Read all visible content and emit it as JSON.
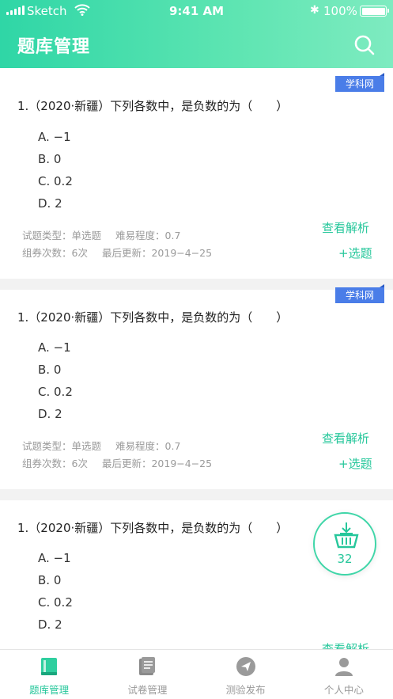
{
  "status_bar": {
    "carrier": "Sketch",
    "time": "9:41 AM",
    "battery": "100%"
  },
  "header": {
    "title": "题库管理"
  },
  "questions": [
    {
      "tag": "学科网",
      "text": "1.（2020·新疆）下列各数中，是负数的为（　　）",
      "options": [
        "A. −1",
        "B. 0",
        "C. 0.2",
        "D. 2"
      ],
      "type_label": "试题类型：单选题",
      "difficulty_label": "难易程度：0.7",
      "count_label": "组券次数：6次",
      "updated_label": "最后更新：2019−4−25",
      "analyze_label": "查看解析",
      "select_label": "+选题"
    },
    {
      "tag": "学科网",
      "text": "1.（2020·新疆）下列各数中，是负数的为（　　）",
      "options": [
        "A. −1",
        "B. 0",
        "C. 0.2",
        "D. 2"
      ],
      "type_label": "试题类型：单选题",
      "difficulty_label": "难易程度：0.7",
      "count_label": "组券次数：6次",
      "updated_label": "最后更新：2019−4−25",
      "analyze_label": "查看解析",
      "select_label": "+选题"
    },
    {
      "text": "1.（2020·新疆）下列各数中，是负数的为（　　）",
      "options": [
        "A. −1",
        "B. 0",
        "C. 0.2",
        "D. 2"
      ],
      "analyze_label": "查看解析"
    }
  ],
  "basket": {
    "count": "32",
    "icon": "basket-icon"
  },
  "tabbar": {
    "items": [
      {
        "label": "题库管理",
        "icon": "book-icon"
      },
      {
        "label": "试卷管理",
        "icon": "paper-icon"
      },
      {
        "label": "测验发布",
        "icon": "send-icon"
      },
      {
        "label": "个人中心",
        "icon": "person-icon"
      }
    ]
  },
  "colors": {
    "accent": "#26c79b",
    "tag_blue": "#4a7de8",
    "inactive": "#999999"
  }
}
